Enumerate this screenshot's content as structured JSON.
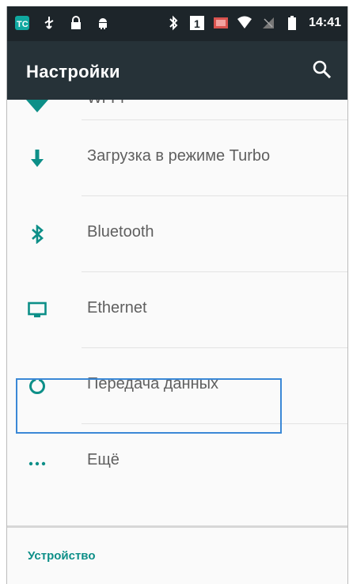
{
  "status_bar": {
    "time": "14:41",
    "left_icons": [
      "tc-app-icon",
      "usb-icon",
      "lock-icon",
      "android-icon"
    ],
    "right_icons": [
      "bluetooth-icon",
      "sim-1-icon",
      "battery-saver-icon",
      "wifi-icon",
      "no-sim-icon",
      "battery-icon"
    ]
  },
  "toolbar": {
    "title": "Настройки",
    "search_icon": "search-icon"
  },
  "settings": {
    "partial_item": {
      "label": "Wi-Fi",
      "icon": "wifi-icon"
    },
    "items": [
      {
        "label": "Загрузка в режиме Turbo",
        "icon": "download-arrow-icon"
      },
      {
        "label": "Bluetooth",
        "icon": "bluetooth-icon"
      },
      {
        "label": "Ethernet",
        "icon": "monitor-icon"
      },
      {
        "label": "Передача данных",
        "icon": "data-usage-icon",
        "selected": true
      },
      {
        "label": "Ещё",
        "icon": "more-dots-icon"
      }
    ],
    "section_device": {
      "title": "Устройство"
    }
  },
  "colors": {
    "statusbar": "#1d252a",
    "toolbar": "#263238",
    "accent": "#0d8f88",
    "selection_border": "#3b88d6"
  }
}
